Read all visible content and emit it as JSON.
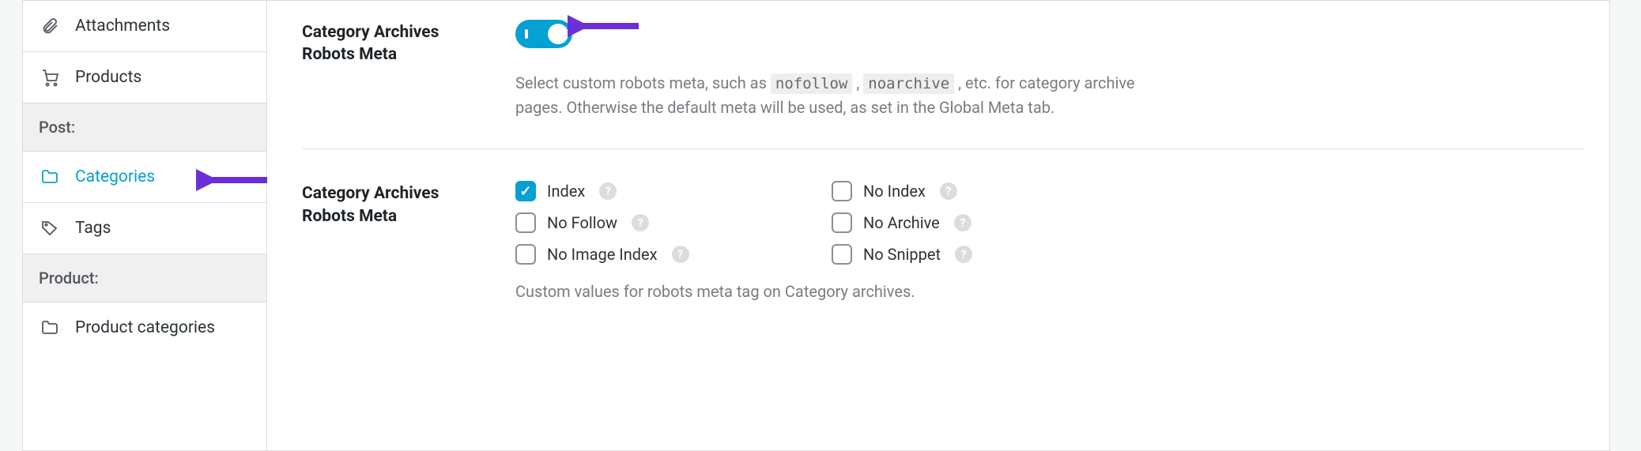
{
  "sidebar": {
    "items": [
      {
        "label": "Attachments"
      },
      {
        "label": "Products"
      }
    ],
    "group1": "Post:",
    "post_items": [
      {
        "label": "Categories"
      },
      {
        "label": "Tags"
      }
    ],
    "group2": "Product:",
    "product_items": [
      {
        "label": "Product categories"
      }
    ]
  },
  "section1": {
    "label": "Category Archives Robots Meta",
    "desc_pre": "Select custom robots meta, such as ",
    "code1": "nofollow",
    "desc_mid": " , ",
    "code2": "noarchive",
    "desc_post": " , etc. for category archive pages. Otherwise the default meta will be used, as set in the Global Meta tab."
  },
  "section2": {
    "label": "Category Archives Robots Meta",
    "options": {
      "index": "Index",
      "noindex": "No Index",
      "nofollow": "No Follow",
      "noarchive": "No Archive",
      "noimageindex": "No Image Index",
      "nosnippet": "No Snippet"
    },
    "subdesc": "Custom values for robots meta tag on Category archives."
  }
}
